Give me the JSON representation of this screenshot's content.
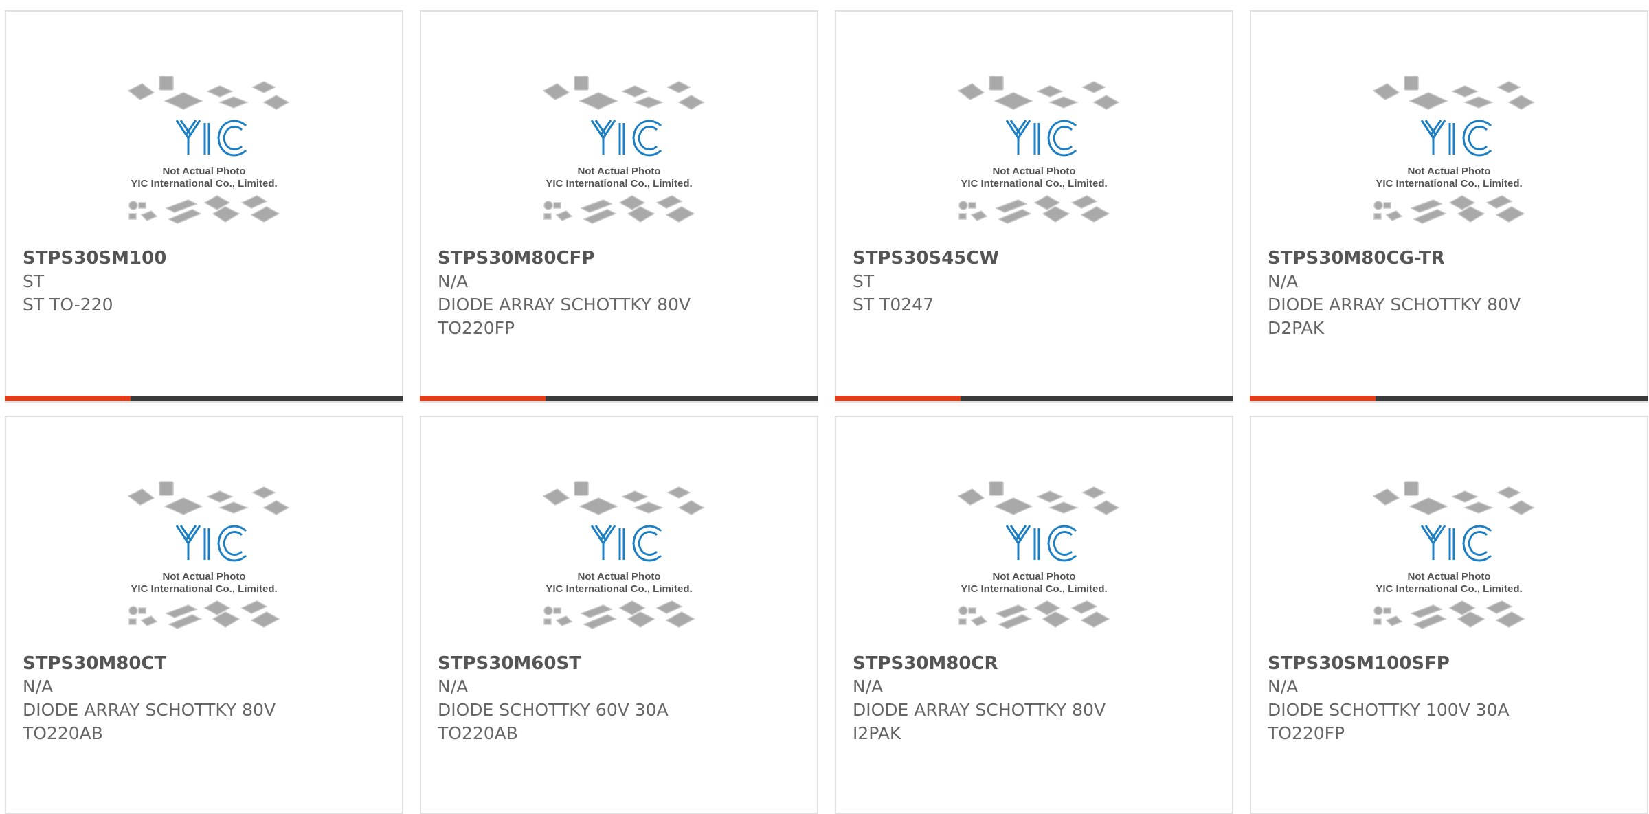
{
  "image_caption": {
    "line1": "Not Actual Photo",
    "line2": "YIC International Co., Limited."
  },
  "colors": {
    "accent": "#e03e18",
    "bar_dark": "#3a3a3a",
    "logo_blue": "#1d7fc4",
    "border": "#e1e1e1"
  },
  "products": [
    {
      "part": "STPS30SM100",
      "brand": "ST",
      "desc1": "ST TO-220",
      "desc2": ""
    },
    {
      "part": "STPS30M80CFP",
      "brand": "N/A",
      "desc1": "DIODE ARRAY SCHOTTKY 80V",
      "desc2": "TO220FP"
    },
    {
      "part": "STPS30S45CW",
      "brand": "ST",
      "desc1": "ST T0247",
      "desc2": ""
    },
    {
      "part": "STPS30M80CG-TR",
      "brand": "N/A",
      "desc1": "DIODE ARRAY SCHOTTKY 80V",
      "desc2": "D2PAK"
    },
    {
      "part": "STPS30M80CT",
      "brand": "N/A",
      "desc1": "DIODE ARRAY SCHOTTKY 80V",
      "desc2": "TO220AB"
    },
    {
      "part": "STPS30M60ST",
      "brand": "N/A",
      "desc1": "DIODE SCHOTTKY 60V 30A",
      "desc2": "TO220AB"
    },
    {
      "part": "STPS30M80CR",
      "brand": "N/A",
      "desc1": "DIODE ARRAY SCHOTTKY 80V",
      "desc2": "I2PAK"
    },
    {
      "part": "STPS30SM100SFP",
      "brand": "N/A",
      "desc1": "DIODE SCHOTTKY 100V 30A",
      "desc2": "TO220FP"
    }
  ]
}
